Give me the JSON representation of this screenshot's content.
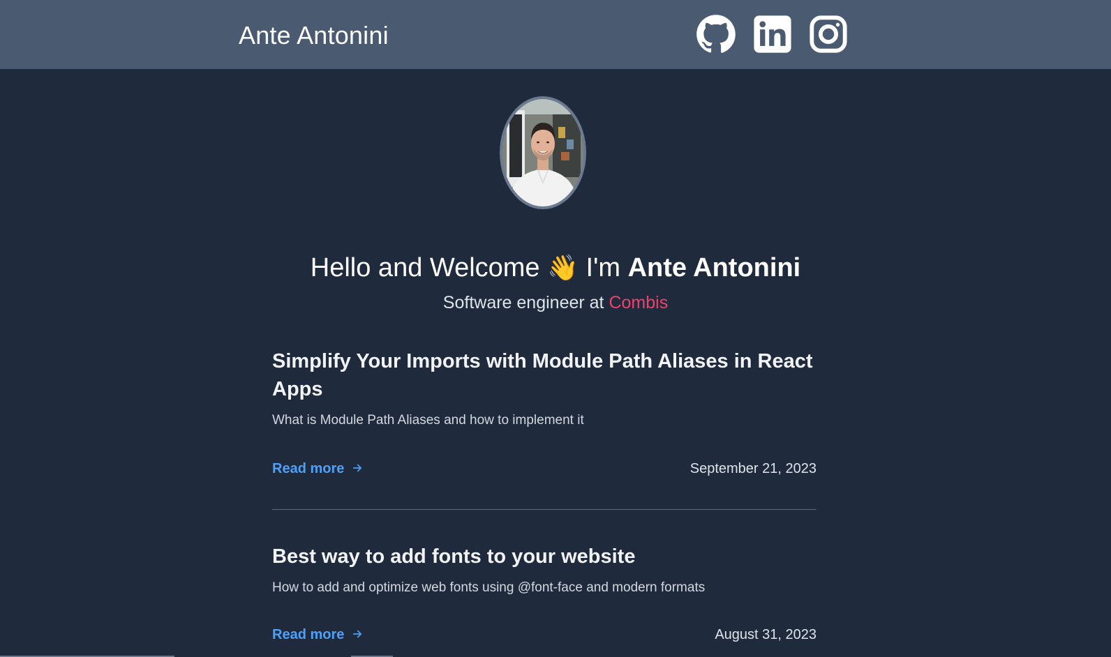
{
  "header": {
    "title": "Ante Antonini",
    "social": [
      {
        "name": "github",
        "icon": "github-icon"
      },
      {
        "name": "linkedin",
        "icon": "linkedin-icon"
      },
      {
        "name": "instagram",
        "icon": "instagram-icon"
      }
    ]
  },
  "hero": {
    "greeting": "Hello and Welcome",
    "wave_emoji": "👋",
    "im": "I'm",
    "name": "Ante Antonini",
    "subtitle_prefix": "Software engineer at",
    "company": "Combis"
  },
  "posts": [
    {
      "title": "Simplify Your Imports with Module Path Aliases in React Apps",
      "description": "What is Module Path Aliases and how to implement it",
      "read_more": "Read more",
      "date": "September 21, 2023"
    },
    {
      "title": "Best way to add fonts to your website",
      "description": "How to add and optimize web fonts using @font-face and modern formats",
      "read_more": "Read more",
      "date": "August 31, 2023"
    }
  ],
  "colors": {
    "header_bg": "#4a5a70",
    "page_bg": "#1f2a3c",
    "link": "#4ea1f6",
    "company": "#f0416c"
  }
}
